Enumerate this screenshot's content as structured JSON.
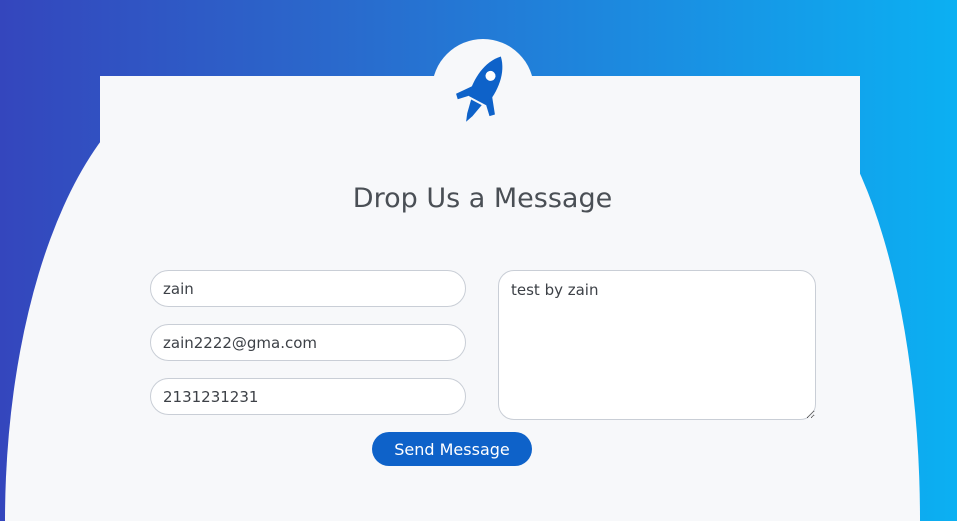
{
  "header": {
    "logo_icon": "rocket-icon",
    "title": "Drop Us a Message"
  },
  "form": {
    "name_value": "zain",
    "email_value": "zain2222@gma.com",
    "phone_value": "2131231231",
    "message_value": "test by zain",
    "submit_label": "Send Message"
  },
  "colors": {
    "gradient_start": "#3446bd",
    "gradient_end": "#0bb0f2",
    "accent": "#0e62c9",
    "card_background": "#f7f8fa"
  }
}
